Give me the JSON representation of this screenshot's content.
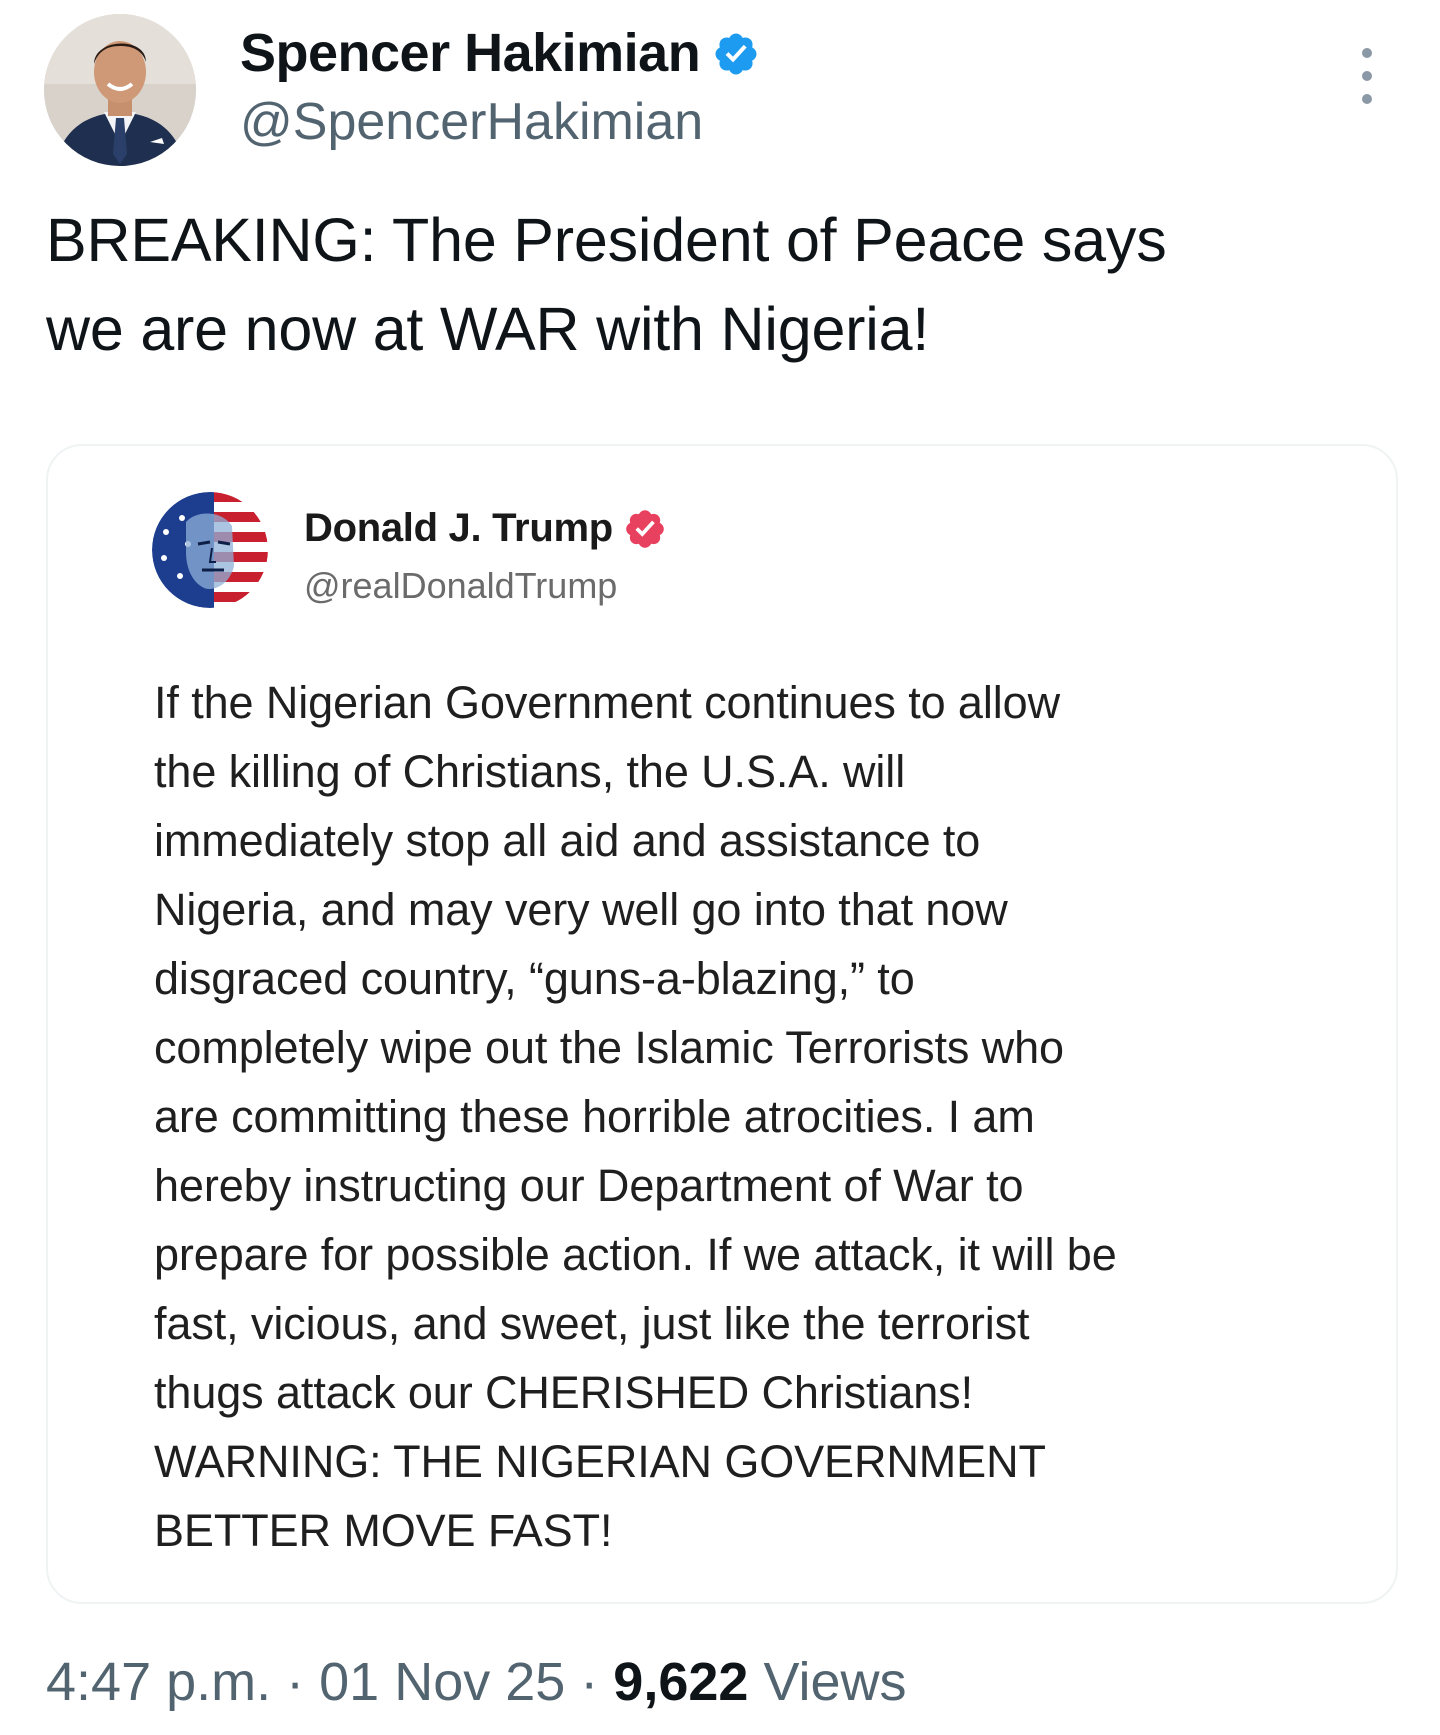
{
  "author": {
    "name": "Spencer Hakimian",
    "handle": "@SpencerHakimian",
    "verified_color": "#1d9bf0"
  },
  "tweet": {
    "text_line1": "BREAKING: The President of Peace says",
    "text_line2": "we are now at WAR with Nigeria!"
  },
  "quoted_post": {
    "author_name": "Donald J. Trump",
    "author_handle": "@realDonaldTrump",
    "verified_color": "#e8405f",
    "lines": [
      "If the Nigerian Government continues to allow",
      "the killing of Christians, the U.S.A. will",
      "immediately stop all aid and assistance to",
      "Nigeria, and may very well go into that now",
      "disgraced country, “guns-a-blazing,” to",
      "completely wipe out the Islamic Terrorists who",
      "are committing these horrible atrocities. I am",
      "hereby instructing our Department of War to",
      "prepare for possible action. If we attack, it will be",
      "fast, vicious, and sweet, just like the terrorist",
      "thugs attack our CHERISHED Christians!",
      "WARNING: THE NIGERIAN GOVERNMENT",
      "BETTER MOVE FAST!"
    ]
  },
  "meta": {
    "time": "4:47 p.m.",
    "separator": " · ",
    "date": "01 Nov 25",
    "views_count": "9,622",
    "views_label": " Views"
  },
  "icons": {
    "more": "more-vertical-icon",
    "verified": "verified-badge-icon"
  }
}
